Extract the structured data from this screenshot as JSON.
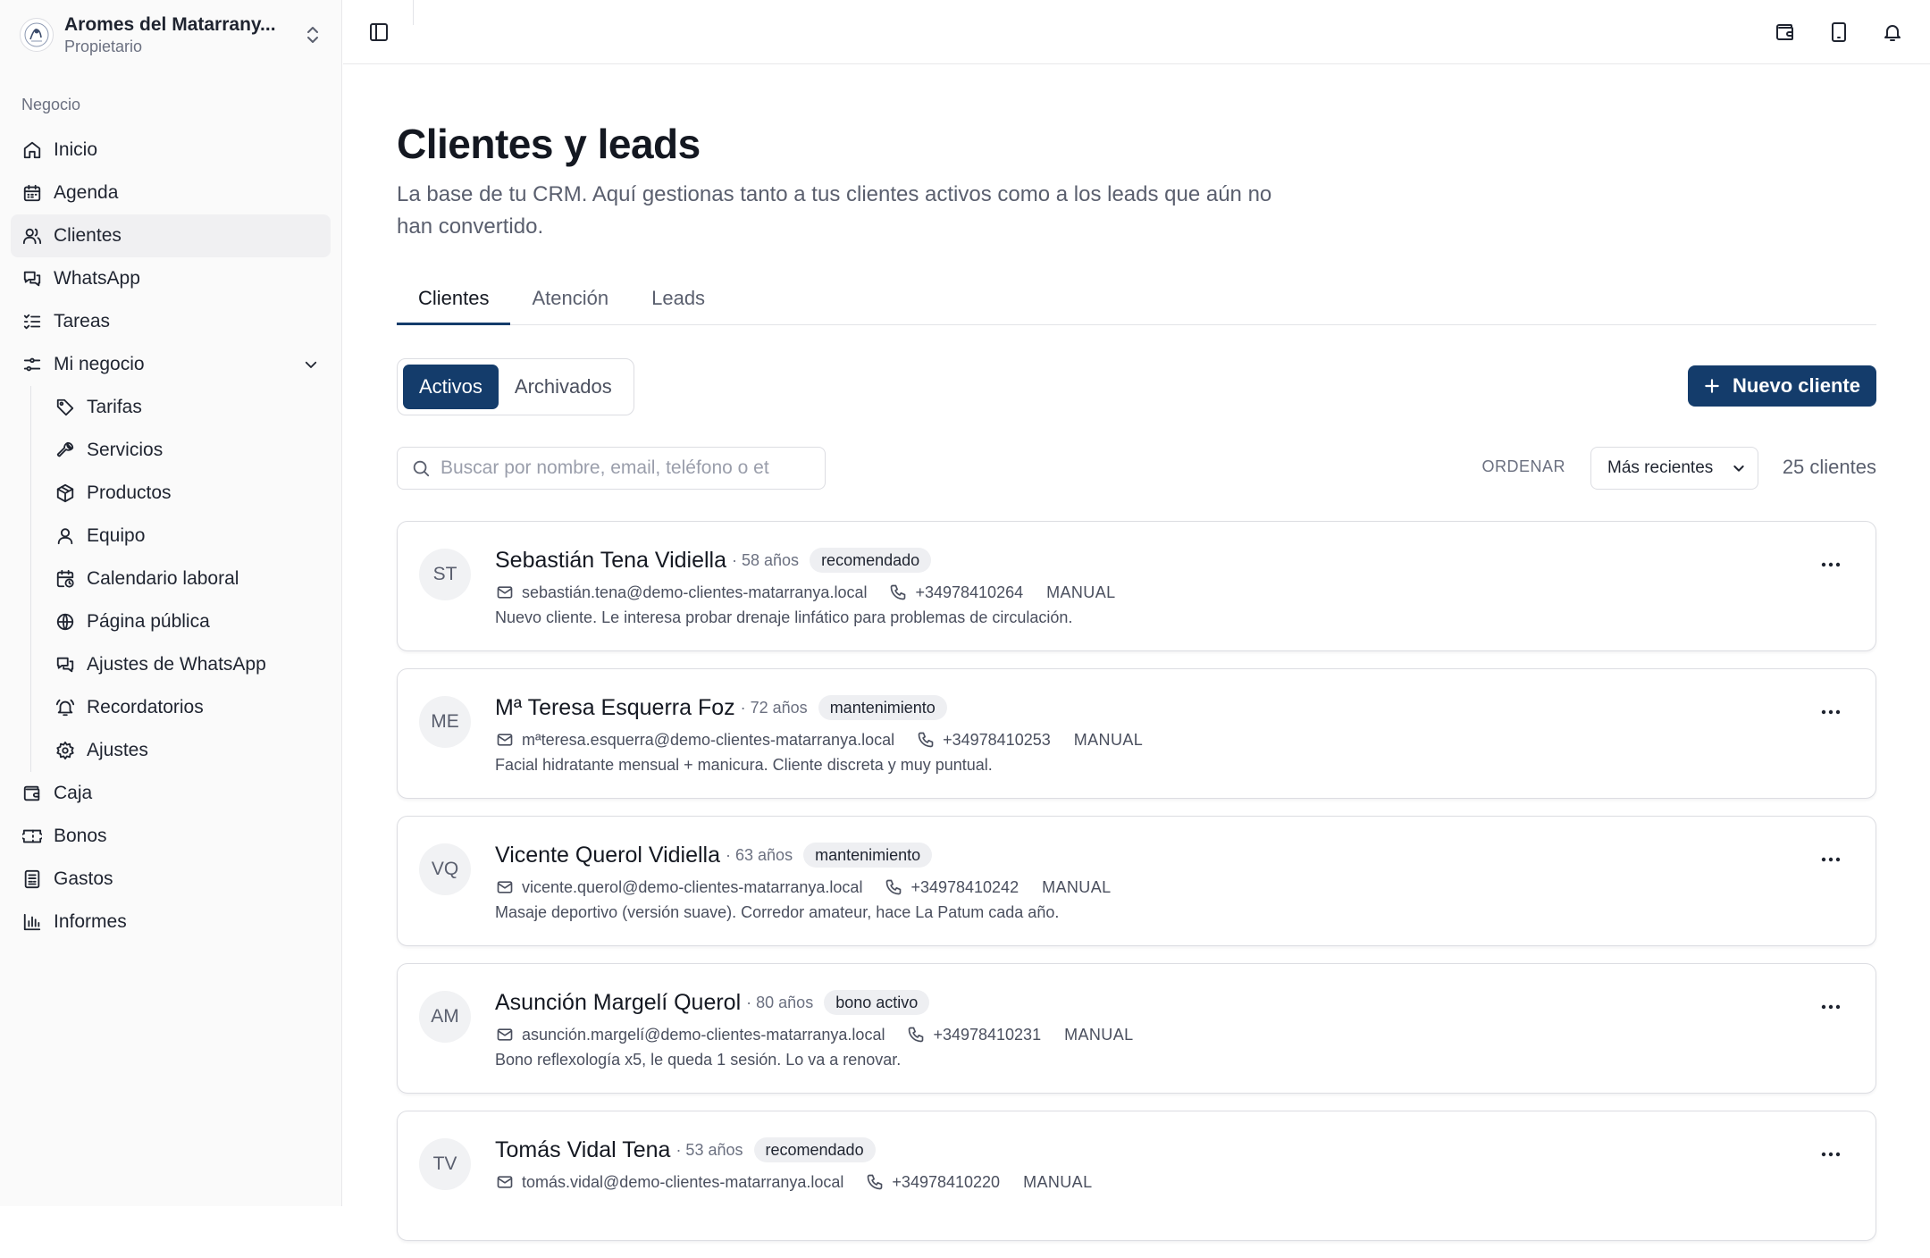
{
  "account": {
    "name": "Aromes del Matarrany...",
    "role": "Propietario"
  },
  "sidebar": {
    "section_label": "Negocio",
    "items": [
      {
        "label": "Inicio",
        "icon": "home-icon"
      },
      {
        "label": "Agenda",
        "icon": "calendar-icon"
      },
      {
        "label": "Clientes",
        "icon": "users-icon",
        "active": true
      },
      {
        "label": "WhatsApp",
        "icon": "chat-icon"
      },
      {
        "label": "Tareas",
        "icon": "tasks-icon"
      },
      {
        "label": "Mi negocio",
        "icon": "sliders-icon",
        "expanded": true
      }
    ],
    "sub_items": [
      {
        "label": "Tarifas",
        "icon": "tag-icon"
      },
      {
        "label": "Servicios",
        "icon": "wrench-icon"
      },
      {
        "label": "Productos",
        "icon": "box-icon"
      },
      {
        "label": "Equipo",
        "icon": "user-icon"
      },
      {
        "label": "Calendario laboral",
        "icon": "calendar-clock-icon"
      },
      {
        "label": "Página pública",
        "icon": "globe-icon"
      },
      {
        "label": "Ajustes de WhatsApp",
        "icon": "chat-icon"
      },
      {
        "label": "Recordatorios",
        "icon": "bell-icon"
      },
      {
        "label": "Ajustes",
        "icon": "gear-icon"
      }
    ],
    "bottom_items": [
      {
        "label": "Caja",
        "icon": "wallet-icon"
      },
      {
        "label": "Bonos",
        "icon": "ticket-icon"
      },
      {
        "label": "Gastos",
        "icon": "receipt-icon"
      },
      {
        "label": "Informes",
        "icon": "bar-chart-icon"
      }
    ]
  },
  "page": {
    "title": "Clientes y leads",
    "description": "La base de tu CRM. Aquí gestionas tanto a tus clientes activos como a los leads que aún no han convertido."
  },
  "tabs": [
    {
      "label": "Clientes",
      "active": true
    },
    {
      "label": "Atención",
      "active": false
    },
    {
      "label": "Leads",
      "active": false
    }
  ],
  "filter": {
    "active": "Activos",
    "archived": "Archivados"
  },
  "new_button": "Nuevo cliente",
  "search": {
    "placeholder": "Buscar por nombre, email, teléfono o et",
    "value": ""
  },
  "sort": {
    "label": "ORDENAR",
    "selected": "Más recientes"
  },
  "count_text": "25 clientes",
  "colors": {
    "primary": "#143c6b",
    "tag_bg": "#eeeff2",
    "border": "#dcdde2"
  },
  "clients": [
    {
      "initials": "ST",
      "name": "Sebastián Tena Vidiella",
      "age": "· 58 años",
      "tag": "recomendado",
      "email": "sebastián.tena@demo-clientes-matarranya.local",
      "phone": "+34978410264",
      "source": "MANUAL",
      "note": "Nuevo cliente. Le interesa probar drenaje linfático para problemas de circulación."
    },
    {
      "initials": "ME",
      "name": "Mª Teresa Esquerra Foz",
      "age": "· 72 años",
      "tag": "mantenimiento",
      "email": "mªteresa.esquerra@demo-clientes-matarranya.local",
      "phone": "+34978410253",
      "source": "MANUAL",
      "note": "Facial hidratante mensual + manicura. Cliente discreta y muy puntual."
    },
    {
      "initials": "VQ",
      "name": "Vicente Querol Vidiella",
      "age": "· 63 años",
      "tag": "mantenimiento",
      "email": "vicente.querol@demo-clientes-matarranya.local",
      "phone": "+34978410242",
      "source": "MANUAL",
      "note": "Masaje deportivo (versión suave). Corredor amateur, hace La Patum cada año."
    },
    {
      "initials": "AM",
      "name": "Asunción Margelí Querol",
      "age": "· 80 años",
      "tag": "bono activo",
      "email": "asunción.margelí@demo-clientes-matarranya.local",
      "phone": "+34978410231",
      "source": "MANUAL",
      "note": "Bono reflexología x5, le queda 1 sesión. Lo va a renovar."
    },
    {
      "initials": "TV",
      "name": "Tomás Vidal Tena",
      "age": "· 53 años",
      "tag": "recomendado",
      "email": "tomás.vidal@demo-clientes-matarranya.local",
      "phone": "+34978410220",
      "source": "MANUAL",
      "note": ""
    }
  ]
}
